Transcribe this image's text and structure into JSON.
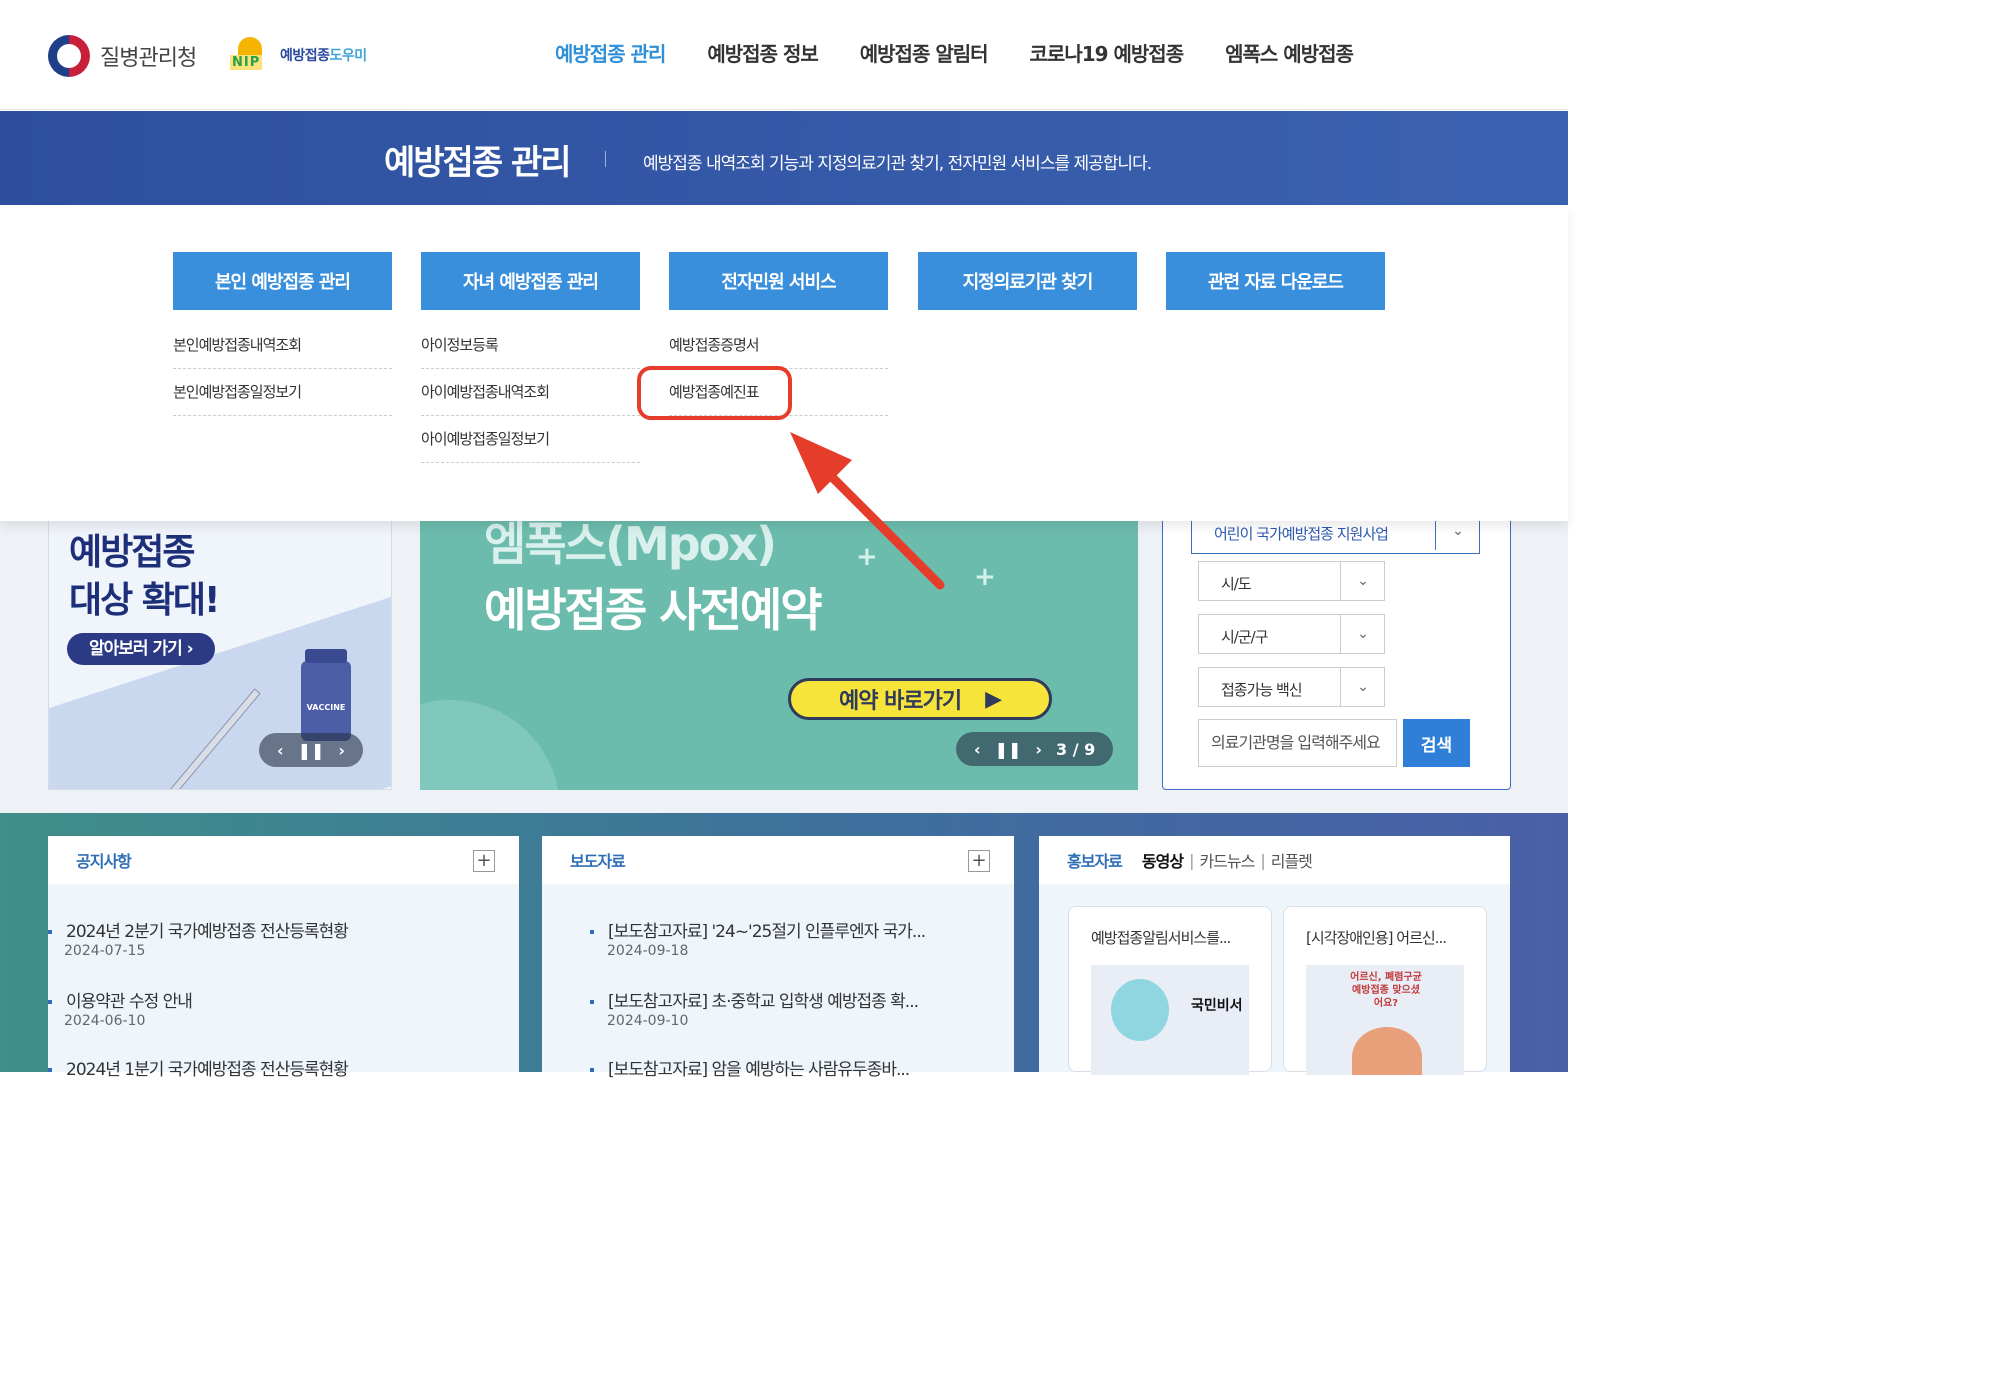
{
  "header": {
    "org_name": "질병관리청",
    "nip_name_main": "예방접종",
    "nip_name_accent": "도우미",
    "nip_mark_text": "NIP",
    "nav": [
      {
        "label": "예방접종 관리",
        "active": true
      },
      {
        "label": "예방접종 정보"
      },
      {
        "label": "예방접종 알림터"
      },
      {
        "label": "코로나19 예방접종"
      },
      {
        "label": "엠폭스 예방접종"
      }
    ]
  },
  "banner": {
    "title": "예방접종 관리",
    "description": "예방접종 내역조회 기능과 지정의료기관 찾기, 전자민원 서비스를 제공합니다."
  },
  "mega_menu": [
    {
      "title": "본인 예방접종 관리",
      "links": [
        "본인예방접종내역조회",
        "본인예방접종일정보기"
      ]
    },
    {
      "title": "자녀 예방접종 관리",
      "links": [
        "아이정보등록",
        "아이예방접종내역조회",
        "아이예방접종일정보기"
      ]
    },
    {
      "title": "전자민원 서비스",
      "links": [
        "예방접종증명서",
        "예방접종예진표"
      ]
    },
    {
      "title": "지정의료기관 찾기",
      "links": []
    },
    {
      "title": "관련 자료 다운로드",
      "links": []
    }
  ],
  "highlight": {
    "target": "예방접종예진표",
    "color": "#e63c2a"
  },
  "left_card": {
    "headline_1": "예방접종",
    "headline_2": "대상 확대!",
    "cta": "알아보러 가기 ›",
    "vial_label": "VACCINE"
  },
  "carousel": {
    "title_1": "엠폭스(Mpox)",
    "title_2": "예방접종 사전예약",
    "reserve_label": "예약 바로가기",
    "counter": "3 / 9"
  },
  "finder": {
    "program": "어린이 국가예방접종 지원사업",
    "city_placeholder": "시/도",
    "district_placeholder": "시/군/구",
    "vaccine_placeholder": "접종가능 백신",
    "search_placeholder": "의료기관명을 입력해주세요",
    "search_button": "검색"
  },
  "notices": {
    "title": "공지사항",
    "items": [
      {
        "title": "2024년 2분기 국가예방접종 전산등록현황",
        "date": "2024-07-15"
      },
      {
        "title": "이용약관 수정 안내",
        "date": "2024-06-10"
      },
      {
        "title": "2024년 1분기 국가예방접종 전산등록현황",
        "date": ""
      }
    ]
  },
  "press": {
    "title": "보도자료",
    "items": [
      {
        "title": "[보도참고자료] '24~'25절기 인플루엔자 국가...",
        "date": "2024-09-18"
      },
      {
        "title": "[보도참고자료] 초·중학교 입학생 예방접종 확...",
        "date": "2024-09-10"
      },
      {
        "title": "[보도참고자료] 암을 예방하는 사람유두종바...",
        "date": ""
      }
    ]
  },
  "promo": {
    "title": "홍보자료",
    "tabs": [
      "동영상",
      "카드뉴스",
      "리플렛"
    ],
    "cards": [
      {
        "title": "예방접종알림서비스를...",
        "image_text": "국민비서"
      },
      {
        "title": "[시각장애인용] 어르신...",
        "image_text": "어르신, 폐렴구균 예방접종 맞으셨어요?"
      }
    ]
  },
  "colors": {
    "primary": "#2d4f9e",
    "accent": "#3a8fdc",
    "highlight": "#e63c2a"
  }
}
